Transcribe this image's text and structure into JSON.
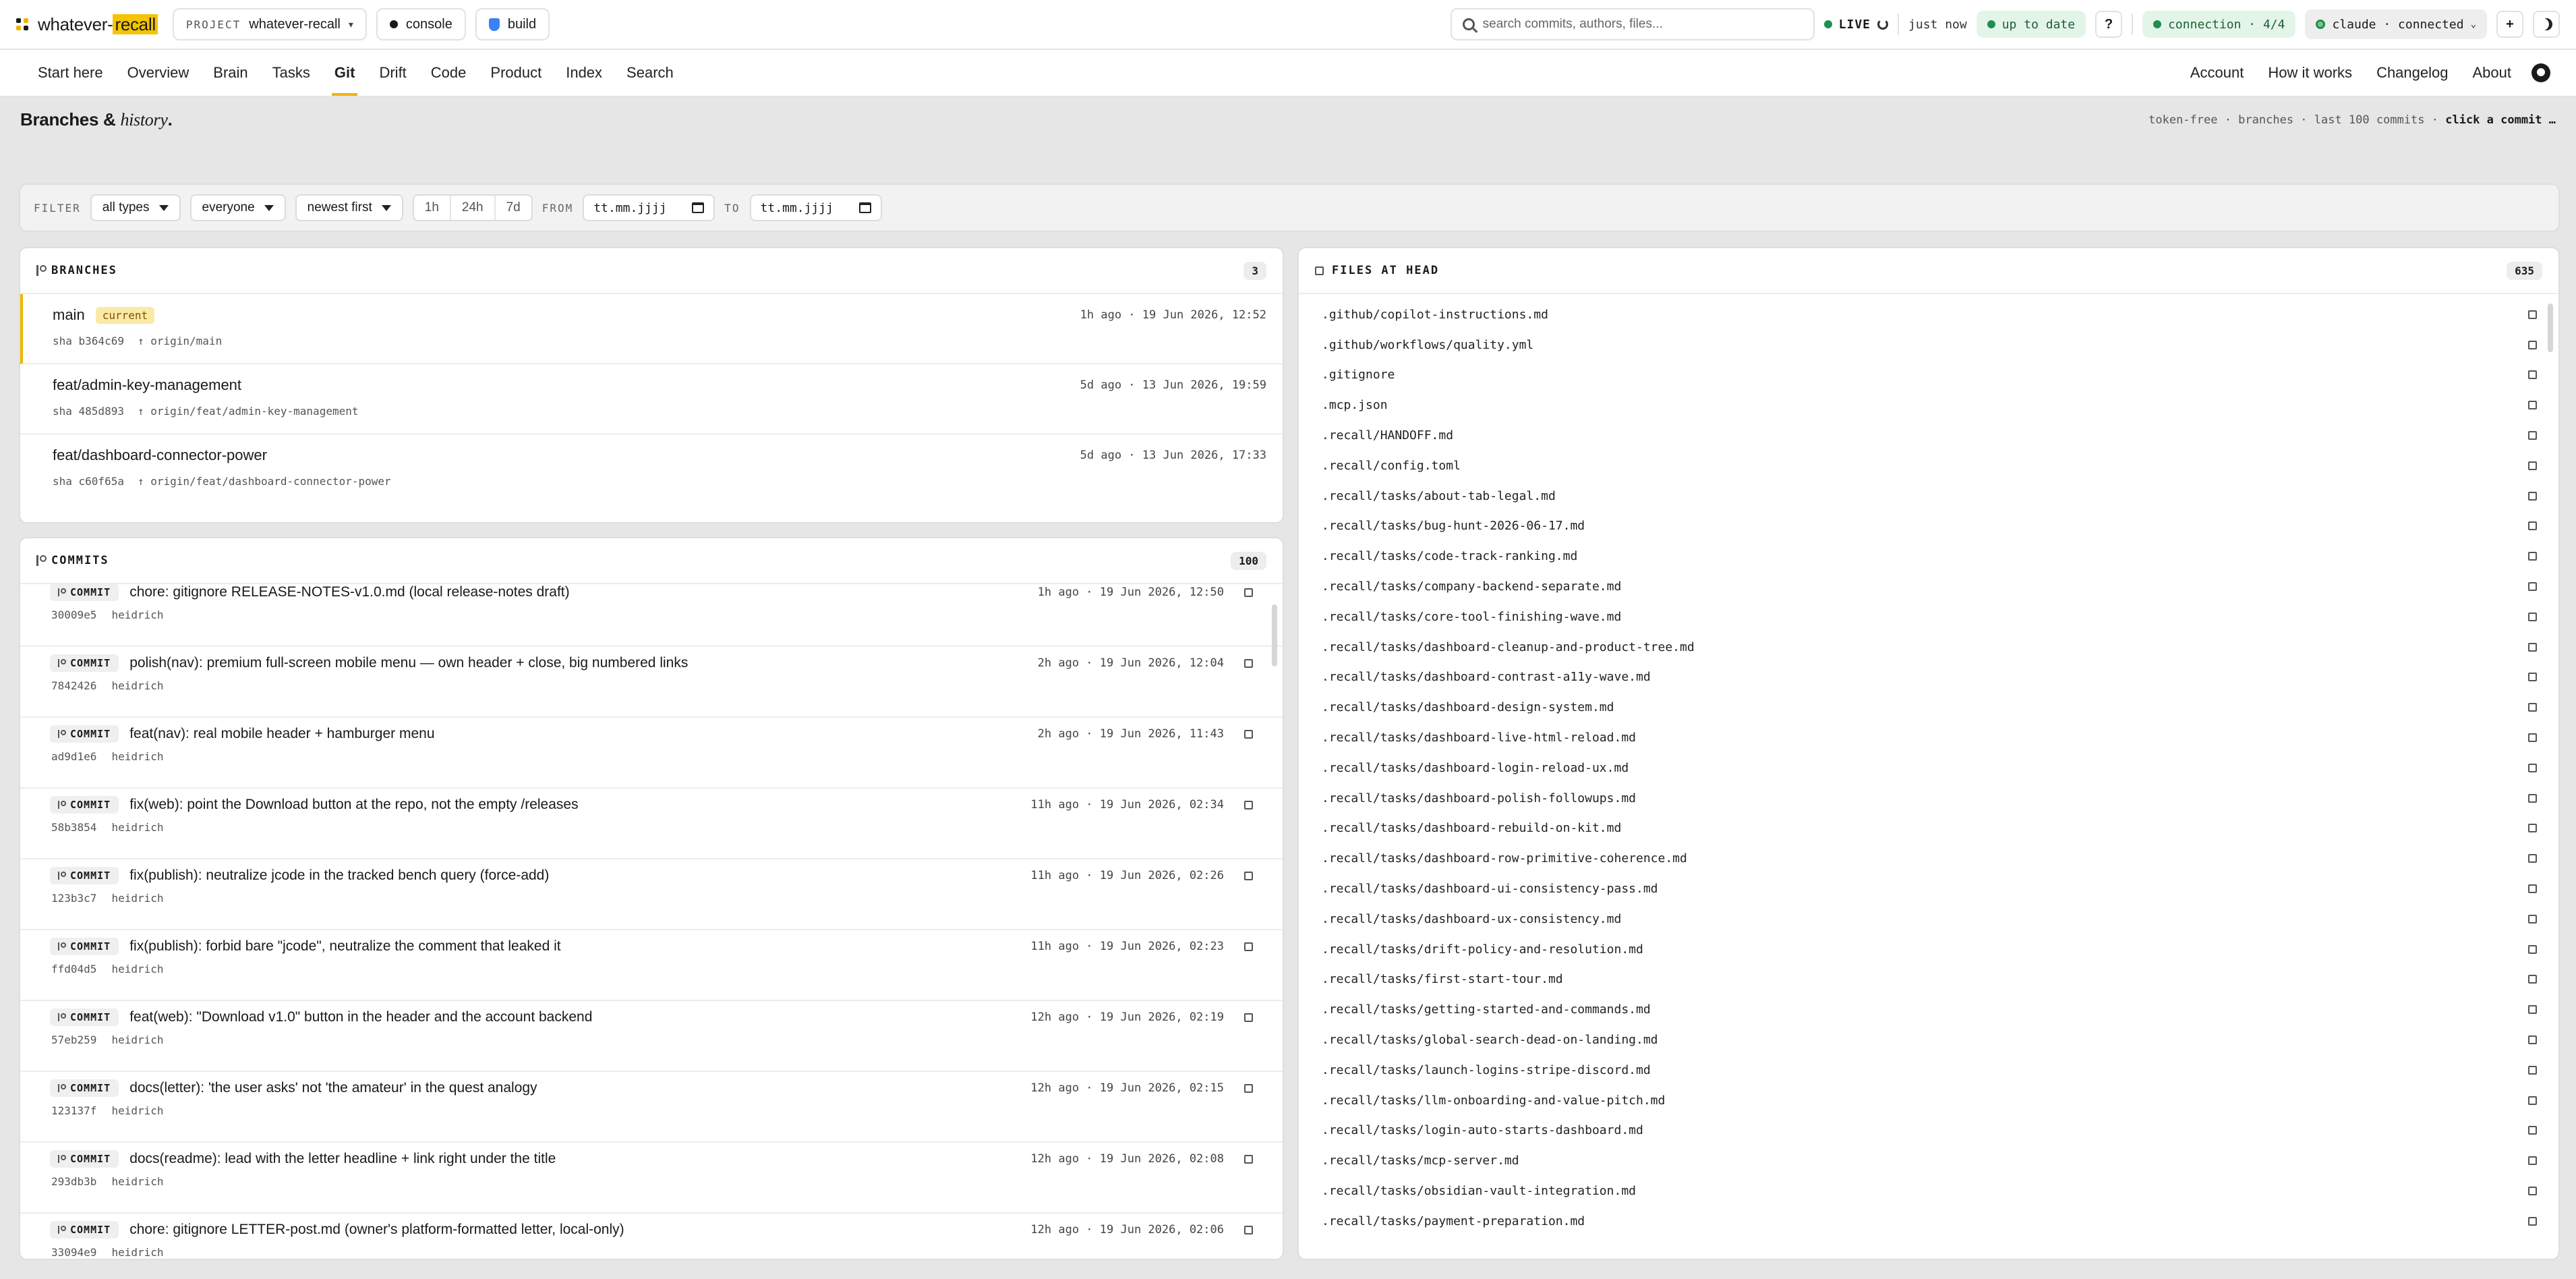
{
  "app": {
    "brand_prefix": "whatever-",
    "brand_highlight": "recall",
    "project_label": "PROJECT",
    "project_name": "whatever-recall",
    "console_label": "console",
    "build_label": "build"
  },
  "topbar": {
    "search_placeholder": "search commits, authors, files...",
    "live_label": "LIVE",
    "updated_label": "just now",
    "status_label": "up to date",
    "help_label": "?",
    "connection_label": "connection · 4/4",
    "claude_label": "claude · connected",
    "add_label": "+"
  },
  "nav": {
    "left": [
      "Start here",
      "Overview",
      "Brain",
      "Tasks",
      "Git",
      "Drift",
      "Code",
      "Product",
      "Index",
      "Search"
    ],
    "active": "Git",
    "right": [
      "Account",
      "How it works",
      "Changelog",
      "About"
    ]
  },
  "page": {
    "title_main": "Branches &",
    "title_em": "history",
    "title_end": ".",
    "meta": "token-free · branches · last 100 commits · ",
    "meta_bold": "click a commit …"
  },
  "filter": {
    "label": "FILTER",
    "type": "all types",
    "author": "everyone",
    "order": "newest first",
    "ranges": [
      "1h",
      "24h",
      "7d"
    ],
    "from_label": "FROM",
    "from_value": "tt.mm.jjjj",
    "to_label": "TO",
    "to_value": "tt.mm.jjjj"
  },
  "branches": {
    "title": "BRANCHES",
    "count": "3",
    "items": [
      {
        "name": "main",
        "tag": "current",
        "time": "1h ago · 19 Jun 2026, 12:52",
        "sha": "sha b364c69",
        "origin": "↑ origin/main"
      },
      {
        "name": "feat/admin-key-management",
        "tag": "",
        "time": "5d ago · 13 Jun 2026, 19:59",
        "sha": "sha 485d893",
        "origin": "↑ origin/feat/admin-key-management"
      },
      {
        "name": "feat/dashboard-connector-power",
        "tag": "",
        "time": "5d ago · 13 Jun 2026, 17:33",
        "sha": "sha c60f65a",
        "origin": "↑ origin/feat/dashboard-connector-power"
      }
    ]
  },
  "commits": {
    "title": "COMMITS",
    "count": "100",
    "tag_label": "COMMIT",
    "items": [
      {
        "msg": "chore: gitignore RELEASE-NOTES-v1.0.md (local release-notes draft)",
        "time": "1h ago · 19 Jun 2026, 12:50",
        "sha": "30009e5",
        "author": "heidrich"
      },
      {
        "msg": "polish(nav): premium full-screen mobile menu — own header + close, big numbered links",
        "time": "2h ago · 19 Jun 2026, 12:04",
        "sha": "7842426",
        "author": "heidrich"
      },
      {
        "msg": "feat(nav): real mobile header + hamburger menu",
        "time": "2h ago · 19 Jun 2026, 11:43",
        "sha": "ad9d1e6",
        "author": "heidrich"
      },
      {
        "msg": "fix(web): point the Download button at the repo, not the empty /releases",
        "time": "11h ago · 19 Jun 2026, 02:34",
        "sha": "58b3854",
        "author": "heidrich"
      },
      {
        "msg": "fix(publish): neutralize jcode in the tracked bench query (force-add)",
        "time": "11h ago · 19 Jun 2026, 02:26",
        "sha": "123b3c7",
        "author": "heidrich"
      },
      {
        "msg": "fix(publish): forbid bare \"jcode\", neutralize the comment that leaked it",
        "time": "11h ago · 19 Jun 2026, 02:23",
        "sha": "ffd04d5",
        "author": "heidrich"
      },
      {
        "msg": "feat(web): \"Download v1.0\" button in the header and the account backend",
        "time": "12h ago · 19 Jun 2026, 02:19",
        "sha": "57eb259",
        "author": "heidrich"
      },
      {
        "msg": "docs(letter): 'the user asks' not 'the amateur' in the quest analogy",
        "time": "12h ago · 19 Jun 2026, 02:15",
        "sha": "123137f",
        "author": "heidrich"
      },
      {
        "msg": "docs(readme): lead with the letter headline + link right under the title",
        "time": "12h ago · 19 Jun 2026, 02:08",
        "sha": "293db3b",
        "author": "heidrich"
      },
      {
        "msg": "chore: gitignore LETTER-post.md (owner's platform-formatted letter, local-only)",
        "time": "12h ago · 19 Jun 2026, 02:06",
        "sha": "33094e9",
        "author": "heidrich"
      }
    ]
  },
  "files": {
    "title": "FILES AT HEAD",
    "count": "635",
    "items": [
      ".github/copilot-instructions.md",
      ".github/workflows/quality.yml",
      ".gitignore",
      ".mcp.json",
      ".recall/HANDOFF.md",
      ".recall/config.toml",
      ".recall/tasks/about-tab-legal.md",
      ".recall/tasks/bug-hunt-2026-06-17.md",
      ".recall/tasks/code-track-ranking.md",
      ".recall/tasks/company-backend-separate.md",
      ".recall/tasks/core-tool-finishing-wave.md",
      ".recall/tasks/dashboard-cleanup-and-product-tree.md",
      ".recall/tasks/dashboard-contrast-a11y-wave.md",
      ".recall/tasks/dashboard-design-system.md",
      ".recall/tasks/dashboard-live-html-reload.md",
      ".recall/tasks/dashboard-login-reload-ux.md",
      ".recall/tasks/dashboard-polish-followups.md",
      ".recall/tasks/dashboard-rebuild-on-kit.md",
      ".recall/tasks/dashboard-row-primitive-coherence.md",
      ".recall/tasks/dashboard-ui-consistency-pass.md",
      ".recall/tasks/dashboard-ux-consistency.md",
      ".recall/tasks/drift-policy-and-resolution.md",
      ".recall/tasks/first-start-tour.md",
      ".recall/tasks/getting-started-and-commands.md",
      ".recall/tasks/global-search-dead-on-landing.md",
      ".recall/tasks/launch-logins-stripe-discord.md",
      ".recall/tasks/llm-onboarding-and-value-pitch.md",
      ".recall/tasks/login-auto-starts-dashboard.md",
      ".recall/tasks/mcp-server.md",
      ".recall/tasks/obsidian-vault-integration.md",
      ".recall/tasks/payment-preparation.md"
    ]
  }
}
